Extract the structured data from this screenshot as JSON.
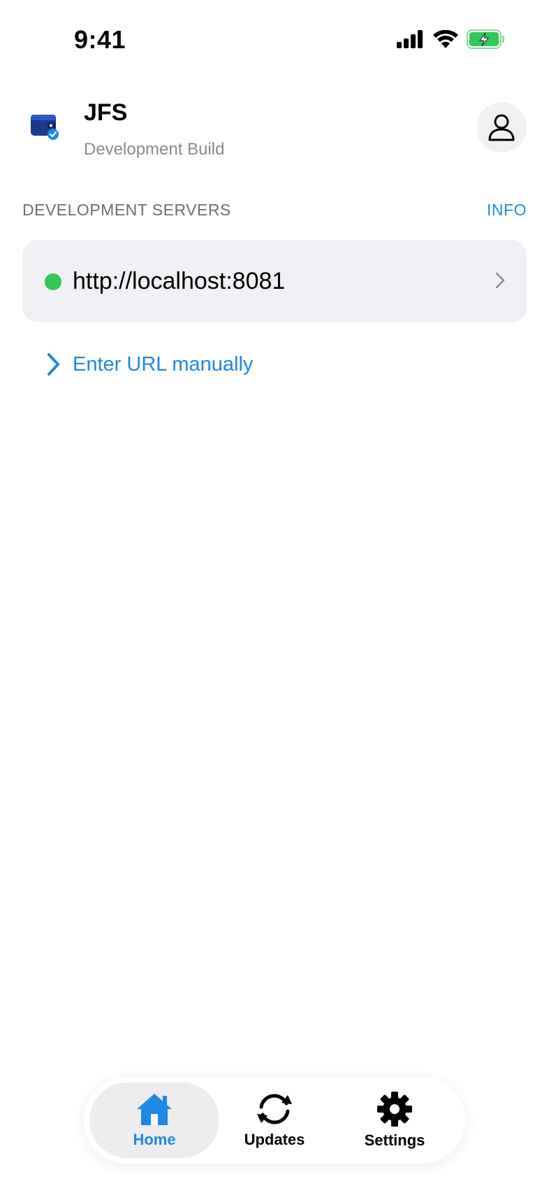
{
  "status_bar": {
    "time": "9:41"
  },
  "header": {
    "title": "JFS",
    "subtitle": "Development Build"
  },
  "section": {
    "title": "DEVELOPMENT SERVERS",
    "info_label": "INFO"
  },
  "servers": [
    {
      "url": "http://localhost:8081",
      "status_color": "#34c759"
    }
  ],
  "manual_entry": {
    "label": "Enter URL manually"
  },
  "tabs": [
    {
      "label": "Home",
      "icon": "home-icon",
      "active": true
    },
    {
      "label": "Updates",
      "icon": "refresh-icon",
      "active": false
    },
    {
      "label": "Settings",
      "icon": "gear-icon",
      "active": false
    }
  ],
  "colors": {
    "accent": "#1e88e5",
    "online": "#34c759",
    "battery": "#34c759"
  }
}
